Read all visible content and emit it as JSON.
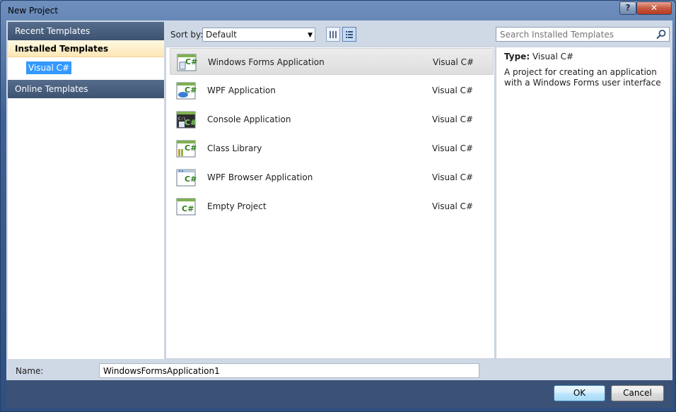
{
  "window": {
    "title": "New Project",
    "help_label": "?"
  },
  "left_pane": {
    "recent_templates": "Recent Templates",
    "installed_templates": "Installed Templates",
    "visual_csharp": "Visual C#",
    "online_templates": "Online Templates"
  },
  "sort": {
    "label": "Sort by:",
    "value": "Default"
  },
  "search": {
    "placeholder": "Search Installed Templates"
  },
  "templates": [
    {
      "name": "Windows Forms Application",
      "language": "Visual C#",
      "icon": "winforms-csharp-icon",
      "selected": true
    },
    {
      "name": "WPF Application",
      "language": "Visual C#",
      "icon": "wpf-csharp-icon",
      "selected": false
    },
    {
      "name": "Console Application",
      "language": "Visual C#",
      "icon": "console-csharp-icon",
      "selected": false
    },
    {
      "name": "Class Library",
      "language": "Visual C#",
      "icon": "class-library-csharp-icon",
      "selected": false
    },
    {
      "name": "WPF Browser Application",
      "language": "Visual C#",
      "icon": "wpf-browser-csharp-icon",
      "selected": false
    },
    {
      "name": "Empty Project",
      "language": "Visual C#",
      "icon": "empty-project-csharp-icon",
      "selected": false
    }
  ],
  "info": {
    "type_label": "Type:",
    "type_value": "Visual C#",
    "description": "A project for creating an application with a Windows Forms user interface"
  },
  "name_field": {
    "label": "Name:",
    "value": "WindowsFormsApplication1"
  },
  "buttons": {
    "ok": "OK",
    "cancel": "Cancel"
  },
  "colors": {
    "accent": "#3399ff",
    "header": "#3e5372",
    "selected_bg": "#fde7b5"
  }
}
